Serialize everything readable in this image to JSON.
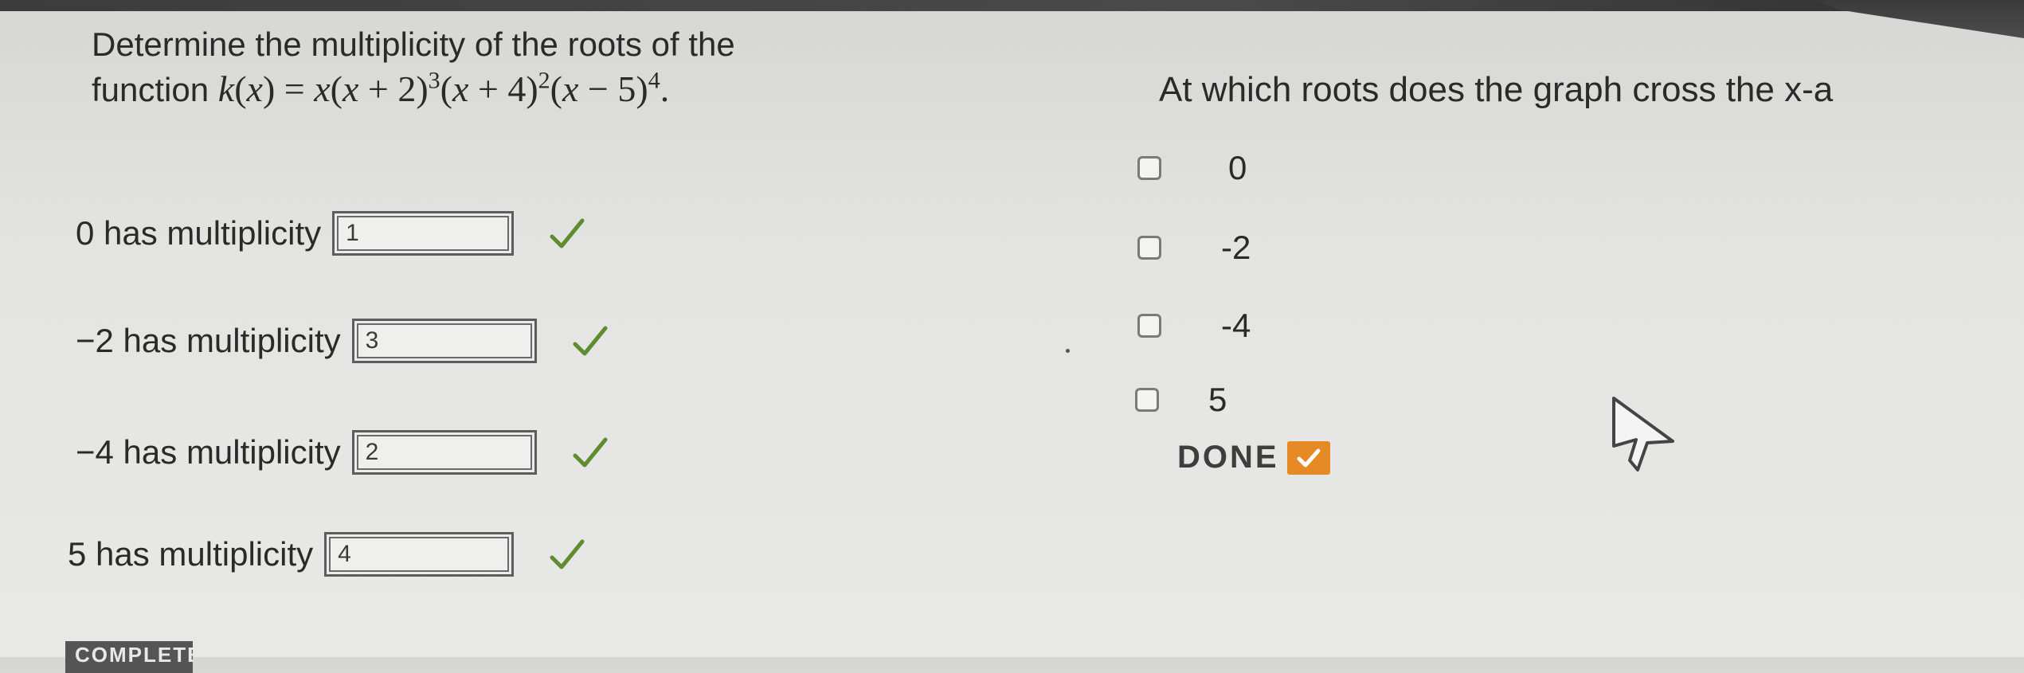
{
  "multiplicity_question": {
    "line1": "Determine the multiplicity of the roots of the",
    "line2_prefix": "function ",
    "function_name": "k",
    "function_var": "x"
  },
  "answers": [
    {
      "label": "0 has multiplicity",
      "value": "1",
      "status": "correct"
    },
    {
      "label": "−2 has multiplicity",
      "value": "3",
      "status": "correct"
    },
    {
      "label": "−4 has multiplicity",
      "value": "2",
      "status": "correct"
    },
    {
      "label": "5 has multiplicity",
      "value": "4",
      "status": "correct"
    }
  ],
  "cross_question": {
    "text": "At which roots does the graph cross the x-a",
    "options": [
      {
        "label": "0",
        "checked": false
      },
      {
        "label": "-2",
        "checked": false
      },
      {
        "label": "-4",
        "checked": false
      },
      {
        "label": "5",
        "checked": false
      }
    ],
    "done_label": "DONE"
  },
  "complete_badge": "COMPLETE",
  "colors": {
    "check_green": "#5e8c2e",
    "done_orange": "#e58a24"
  },
  "icons": {
    "answer_status": "checkmark-icon",
    "done_status": "checkmark-icon",
    "pointer": "mouse-cursor-icon"
  }
}
